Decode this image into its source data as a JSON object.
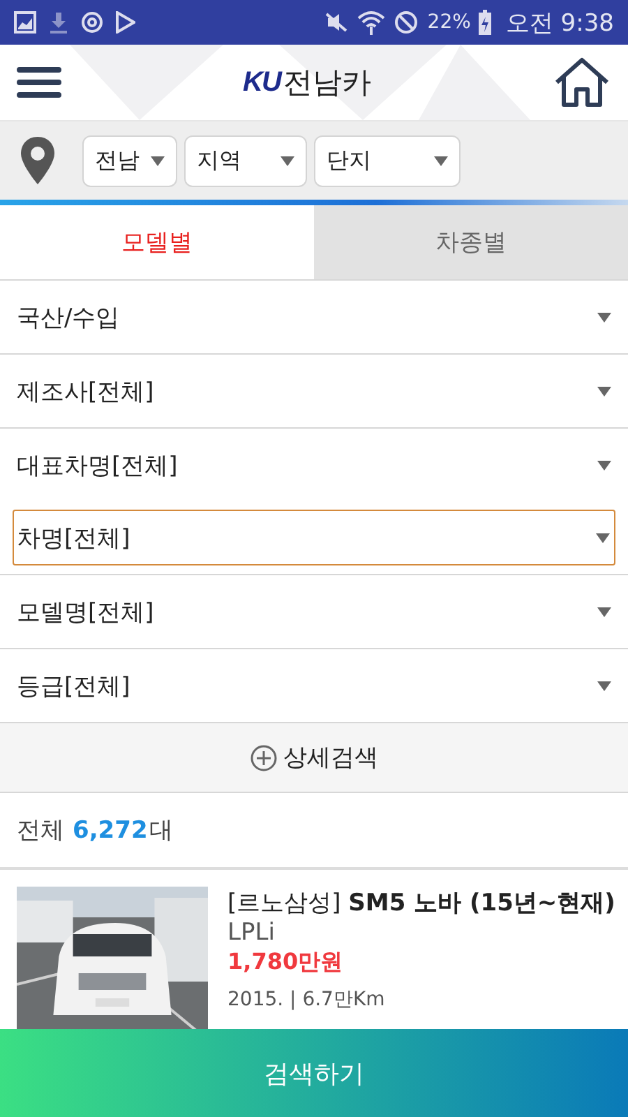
{
  "status_bar": {
    "battery": "22%",
    "time": "오전 9:38"
  },
  "header": {
    "logo_mark": "KU",
    "logo_text": "전남카"
  },
  "location_filters": [
    {
      "label": "전남"
    },
    {
      "label": "지역"
    },
    {
      "label": "단지"
    }
  ],
  "tabs": [
    {
      "label": "모델별",
      "selected": true
    },
    {
      "label": "차종별",
      "selected": false
    }
  ],
  "filters": [
    {
      "label": "국산/수입",
      "focused": false
    },
    {
      "label": "제조사[전체]",
      "focused": false
    },
    {
      "label": "대표차명[전체]",
      "focused": false
    },
    {
      "label": "차명[전체]",
      "focused": true
    },
    {
      "label": "모델명[전체]",
      "focused": false
    },
    {
      "label": "등급[전체]",
      "focused": false
    }
  ],
  "detail_search": {
    "label": "상세검색"
  },
  "total": {
    "label": "전체",
    "count": "6,272",
    "unit": "대"
  },
  "listing": {
    "title_brand": "[르노삼성]",
    "title": "SM5 노바 (15년~현재)",
    "subtitle": "LPLi",
    "price": "1,780만원",
    "specs": "2015. | 6.7만Km"
  },
  "search_button": {
    "label": "검색하기"
  }
}
